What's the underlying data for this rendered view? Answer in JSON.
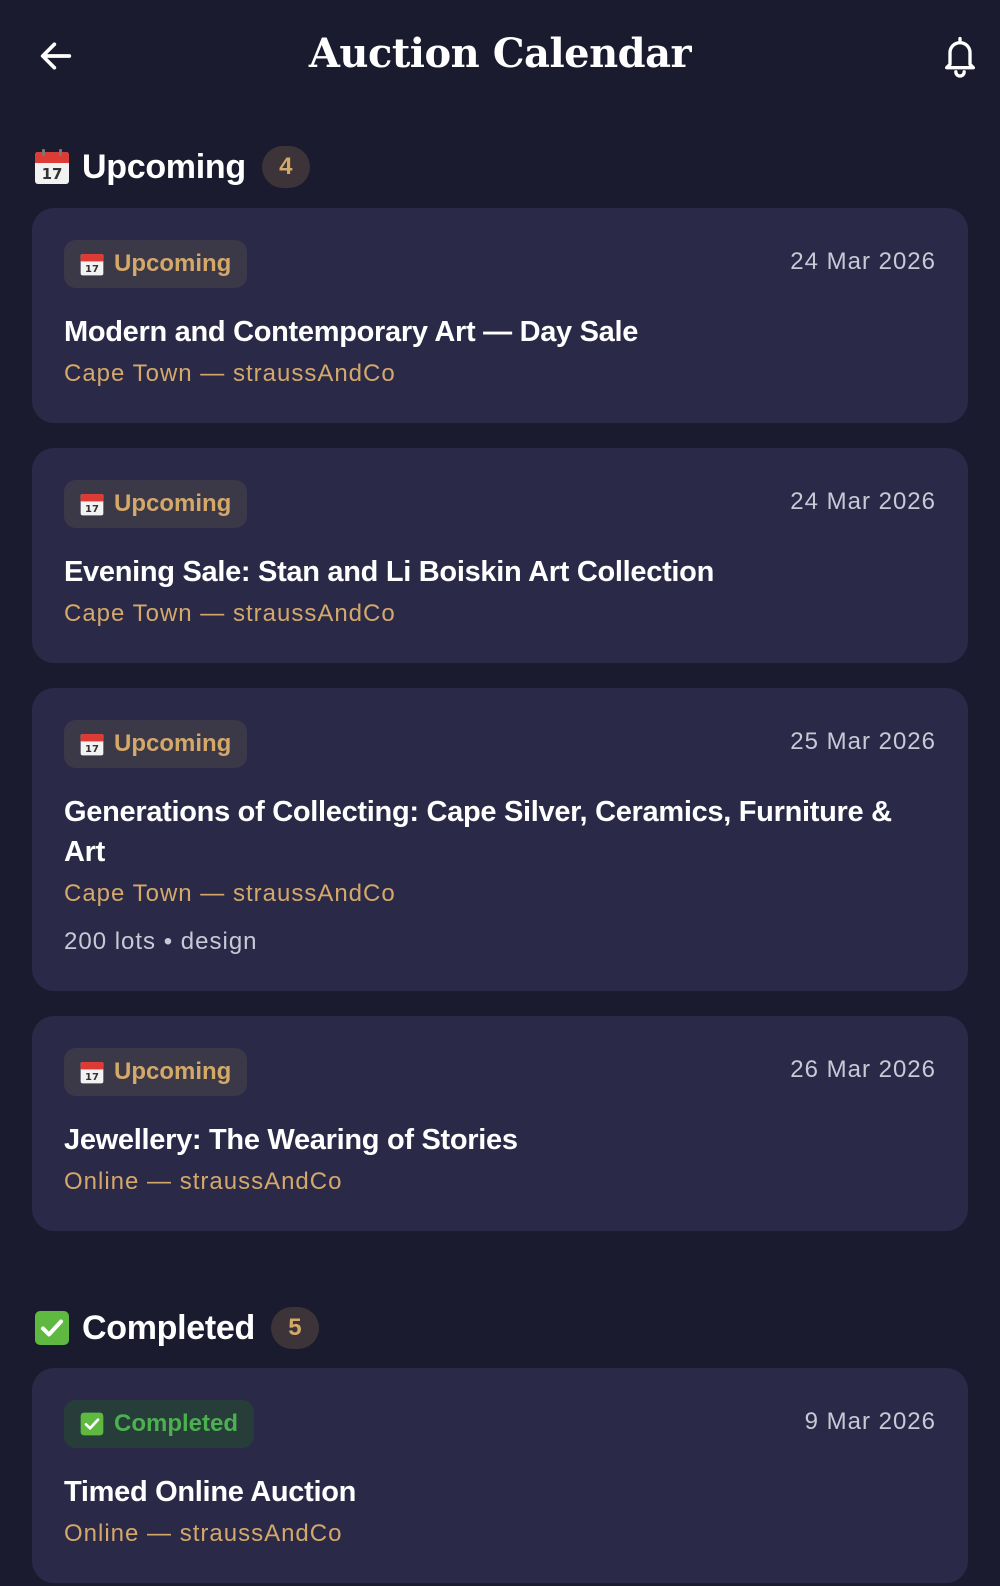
{
  "header": {
    "title": "Auction Calendar",
    "back_icon": "arrow-left-icon",
    "notification_icon": "bell-icon"
  },
  "colors": {
    "background": "#1b1b2f",
    "card": "#2a2a48",
    "accent_gold": "#d4a869",
    "completed_green": "#4caf50"
  },
  "sections": {
    "upcoming": {
      "icon": "calendar-icon",
      "title": "Upcoming",
      "count": "4"
    },
    "completed": {
      "icon": "check-mark-icon",
      "title": "Completed",
      "count": "5"
    }
  },
  "auctions": [
    {
      "status": "Upcoming",
      "date": "24 Mar 2026",
      "title": "Modern and Contemporary Art — Day Sale",
      "location": "Cape Town — straussAndCo"
    },
    {
      "status": "Upcoming",
      "date": "24 Mar 2026",
      "title": "Evening Sale: Stan and Li Boiskin Art Collection",
      "location": "Cape Town — straussAndCo"
    },
    {
      "status": "Upcoming",
      "date": "25 Mar 2026",
      "title": "Generations of Collecting: Cape Silver, Ceramics, Furniture & Art",
      "location": "Cape Town — straussAndCo",
      "meta": "200 lots • design"
    },
    {
      "status": "Upcoming",
      "date": "26 Mar 2026",
      "title": "Jewellery: The Wearing of Stories",
      "location": "Online — straussAndCo"
    },
    {
      "status": "Completed",
      "date": "9 Mar 2026",
      "title": "Timed Online Auction",
      "location": "Online — straussAndCo"
    }
  ]
}
